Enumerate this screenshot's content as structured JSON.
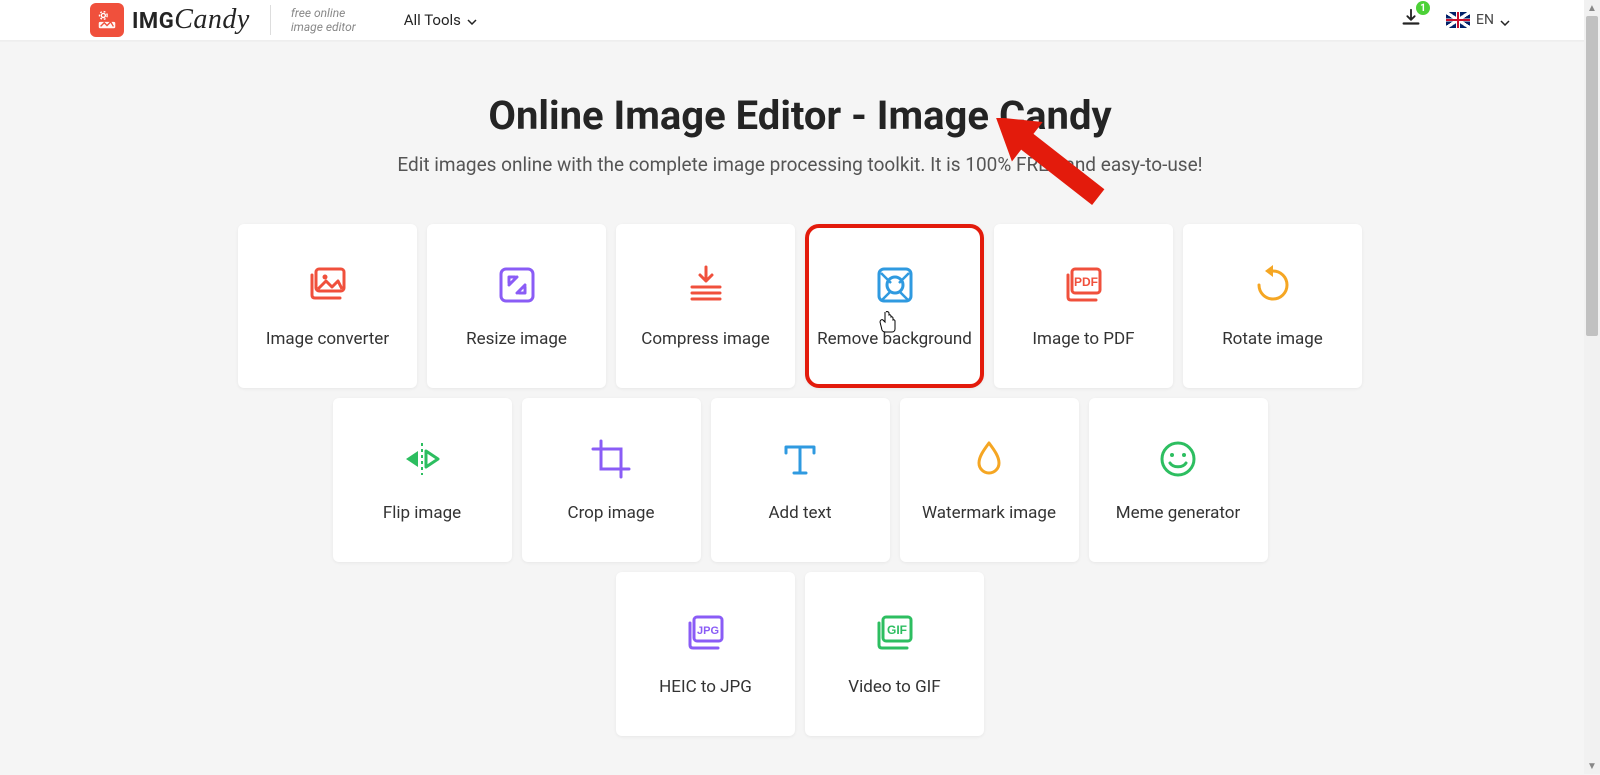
{
  "brand": {
    "name_pre": "IMG",
    "name_post": "Candy",
    "tagline_l1": "free online",
    "tagline_l2": "image editor"
  },
  "header": {
    "all_tools": "All Tools",
    "download_badge": "1",
    "lang": "EN"
  },
  "page": {
    "title": "Online Image Editor - Image Candy",
    "subtitle": "Edit images online with the complete image processing toolkit. It is 100% FREE and easy-to-use!"
  },
  "tools": {
    "row1": [
      {
        "id": "image-converter",
        "label": "Image converter",
        "icon": "image-stack",
        "color": "#F0503C"
      },
      {
        "id": "resize-image",
        "label": "Resize image",
        "icon": "resize",
        "color": "#8A5CF6"
      },
      {
        "id": "compress-image",
        "label": "Compress image",
        "icon": "compress",
        "color": "#F0503C"
      },
      {
        "id": "remove-background",
        "label": "Remove background",
        "icon": "remove-bg",
        "color": "#2F9AE0",
        "highlight": true
      },
      {
        "id": "image-to-pdf",
        "label": "Image to PDF",
        "icon": "pdf",
        "color": "#F0503C"
      },
      {
        "id": "rotate-image",
        "label": "Rotate image",
        "icon": "rotate",
        "color": "#F5A623"
      }
    ],
    "row2": [
      {
        "id": "flip-image",
        "label": "Flip image",
        "icon": "flip",
        "color": "#2DBE60"
      },
      {
        "id": "crop-image",
        "label": "Crop image",
        "icon": "crop",
        "color": "#8A5CF6"
      },
      {
        "id": "add-text",
        "label": "Add text",
        "icon": "text",
        "color": "#2F9AE0"
      },
      {
        "id": "watermark-image",
        "label": "Watermark image",
        "icon": "watermark",
        "color": "#F5A623"
      },
      {
        "id": "meme-generator",
        "label": "Meme generator",
        "icon": "meme",
        "color": "#2DBE60"
      }
    ],
    "row3": [
      {
        "id": "heic-to-jpg",
        "label": "HEIC to JPG",
        "icon": "jpg",
        "color": "#8A5CF6"
      },
      {
        "id": "video-to-gif",
        "label": "Video to GIF",
        "icon": "gif",
        "color": "#2DBE60"
      }
    ]
  }
}
